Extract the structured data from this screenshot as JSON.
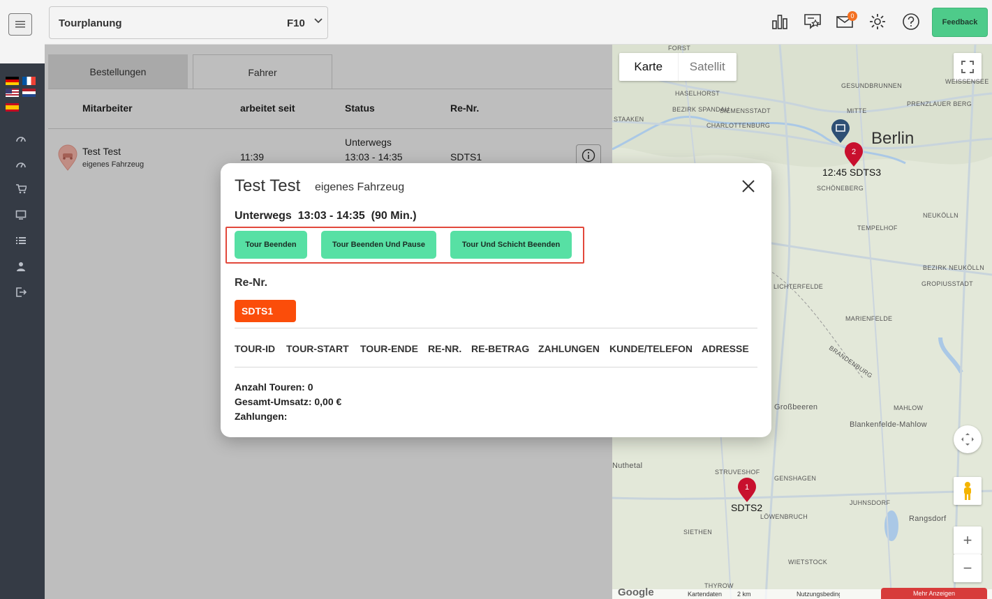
{
  "header": {
    "page_title": "Tourplanung",
    "page_shortcut": "F10",
    "mail_badge": "0",
    "feedback_label": "Feedback"
  },
  "tabs": [
    {
      "label": "Bestellungen",
      "active": true
    },
    {
      "label": "Fahrer",
      "active": false
    }
  ],
  "table": {
    "columns": [
      "Mitarbeiter",
      "arbeitet seit",
      "Status",
      "Re-Nr."
    ],
    "rows": [
      {
        "name": "Test Test",
        "vehicle": "eigenes Fahrzeug",
        "since": "11:39",
        "status_line1": "Unterwegs",
        "status_line2": "13:03 - 14:35",
        "renr": "SDTS1"
      }
    ]
  },
  "map": {
    "type_options": [
      "Karte",
      "Satellit"
    ],
    "city": "Berlin",
    "markers": [
      {
        "number": "2",
        "label": "12:45 SDTS3"
      },
      {
        "number": "1",
        "label": "SDTS2"
      }
    ],
    "place_labels": [
      "HASELHORST",
      "SIEMENSSTADT",
      "BEZIRK SPANDAU",
      "CHARLOTTENBURG",
      "MITTE",
      "GESUNDBRUNNEN",
      "PRENZLAUER BERG",
      "WEISSENSEE",
      "SCHÖNEBERG",
      "TEMPELHOF",
      "NEUKÖLLN",
      "BEZIRK NEUKÖLLN",
      "LICHTERFELDE",
      "GROPIUSSTADT",
      "MARIENFELDE",
      "BRANDENBURG",
      "Großbeeren",
      "MAHLOW",
      "Blankenfelde-Mahlow",
      "STRUVESHOF",
      "GENSHAGEN",
      "JUHNSDORF",
      "Rangsdorf",
      "LÖWENBRUCH",
      "SIETHEN",
      "WIETSTOCK",
      "THYROW",
      "Nuthetal",
      "STAAKEN",
      "FORST"
    ],
    "footer": [
      "Kartendaten",
      "2 km",
      "Nutzungsbedingungen",
      "Mehr Anzeigen"
    ],
    "google": "Google"
  },
  "modal": {
    "name": "Test Test",
    "vehicle": "eigenes Fahrzeug",
    "status": "Unterwegs  13:03 - 14:35  (90 Min.)",
    "actions": [
      "Tour Beenden",
      "Tour Beenden Und Pause",
      "Tour Und Schicht Beenden"
    ],
    "renr_label": "Re-Nr.",
    "renr_value": "SDTS1",
    "tour_columns": [
      "TOUR-ID",
      "TOUR-START",
      "TOUR-ENDE",
      "RE-NR.",
      "RE-BETRAG",
      "ZAHLUNGEN",
      "KUNDE/TELEFON",
      "ADRESSE"
    ],
    "summary": {
      "tours": "Anzahl Touren: 0",
      "revenue": "Gesamt-Umsatz: 0,00 €",
      "payments": "Zahlungen:"
    }
  },
  "colors": {
    "accent_green": "#57e0a4",
    "feedback_green": "#4ecb8a",
    "renr_orange": "#fb4d0a",
    "highlight_red": "#e2483b",
    "sidebar_dark": "#353b45"
  }
}
